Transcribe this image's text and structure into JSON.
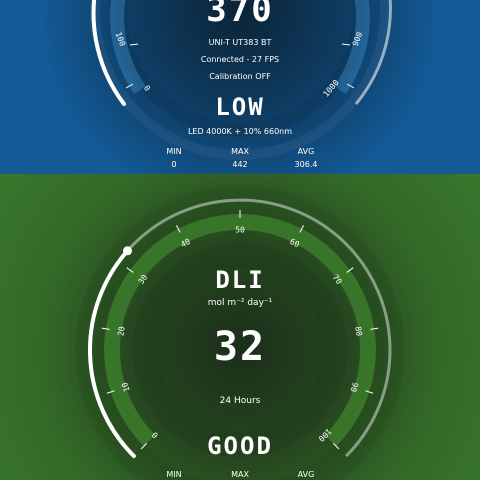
{
  "top_panel": {
    "reading": "370",
    "device": "UNI-T UT383 BT",
    "connection": "Connected - 27 FPS",
    "calibration": "Calibration OFF",
    "status": "LOW",
    "light_source": "LED 4000K + 10% 660nm",
    "gauge_ticks": [
      "100",
      "0",
      "900",
      "1000"
    ],
    "stats": {
      "min_label": "MIN",
      "max_label": "MAX",
      "avg_label": "AVG",
      "min_value": "0",
      "max_value": "442",
      "avg_value": "306.4"
    }
  },
  "bottom_panel": {
    "title": "DLI",
    "unit": "mol m⁻² day⁻¹",
    "value": "32",
    "period": "24 Hours",
    "status": "GOOD",
    "gauge_value": 32,
    "gauge_max": 100,
    "gauge_ticks": [
      "0",
      "10",
      "20",
      "30",
      "40",
      "50",
      "60",
      "70",
      "80",
      "90",
      "100"
    ],
    "stats": {
      "min_label": "MIN",
      "max_label": "MAX",
      "avg_label": "AVG"
    }
  },
  "colors": {
    "top_bg": "#135a97",
    "bottom_bg": "#3a7a2d",
    "arc": "#ffffff"
  }
}
